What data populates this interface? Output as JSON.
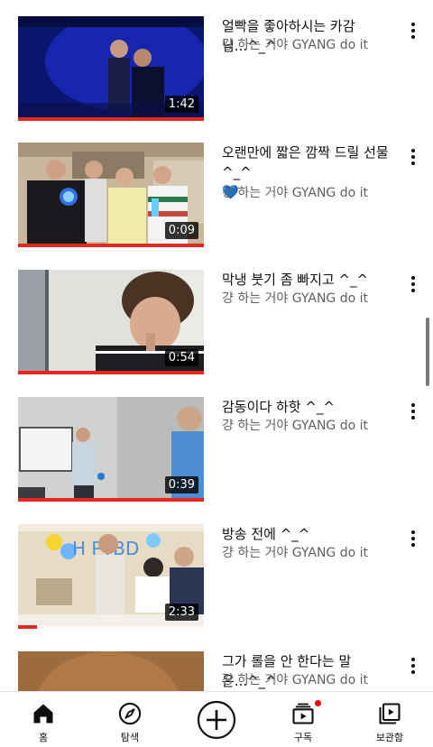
{
  "videos": [
    {
      "title": "얼빡을 좋아하시는 카감님...^_^",
      "channel": "걍 하는 거야 GYANG do it",
      "duration": "1:42",
      "watched": 1.0
    },
    {
      "title": "오랜만에 짧은 깜짝 드릴 선물 ^_^",
      "title_emoji": "💙",
      "channel": "걍 하는 거야 GYANG do it",
      "duration": "0:09",
      "watched": 1.0
    },
    {
      "title": "막냉 붓기 좀 빠지고 ^_^",
      "channel": "걍 하는 거야 GYANG do it",
      "duration": "0:54",
      "watched": 1.0
    },
    {
      "title": "감동이다 하핫 ^_^",
      "channel": "걍 하는 거야 GYANG do it",
      "duration": "0:39",
      "watched": 1.0
    },
    {
      "title": "방송 전에 ^_^",
      "channel": "걍 하는 거야 GYANG do it",
      "duration": "2:33",
      "watched": 0.1
    },
    {
      "title": "그가 롤을 안 한다는 말은...^_^",
      "channel": "걍 하는 거야 GYANG do it",
      "duration": "",
      "watched": 0
    }
  ],
  "bottom_nav": {
    "home": "홈",
    "explore": "탐색",
    "create": "",
    "subscriptions": "구독",
    "library": "보관함"
  },
  "colors": {
    "progress": "#e5281f",
    "notification": "#ff0000",
    "text_primary": "#0f0f0f",
    "text_secondary": "#606060"
  },
  "icons": {
    "home": "home-icon",
    "explore": "compass-icon",
    "create": "add-circle-icon",
    "subscriptions": "subscriptions-icon",
    "library": "library-icon",
    "menu": "more-vert-icon"
  }
}
